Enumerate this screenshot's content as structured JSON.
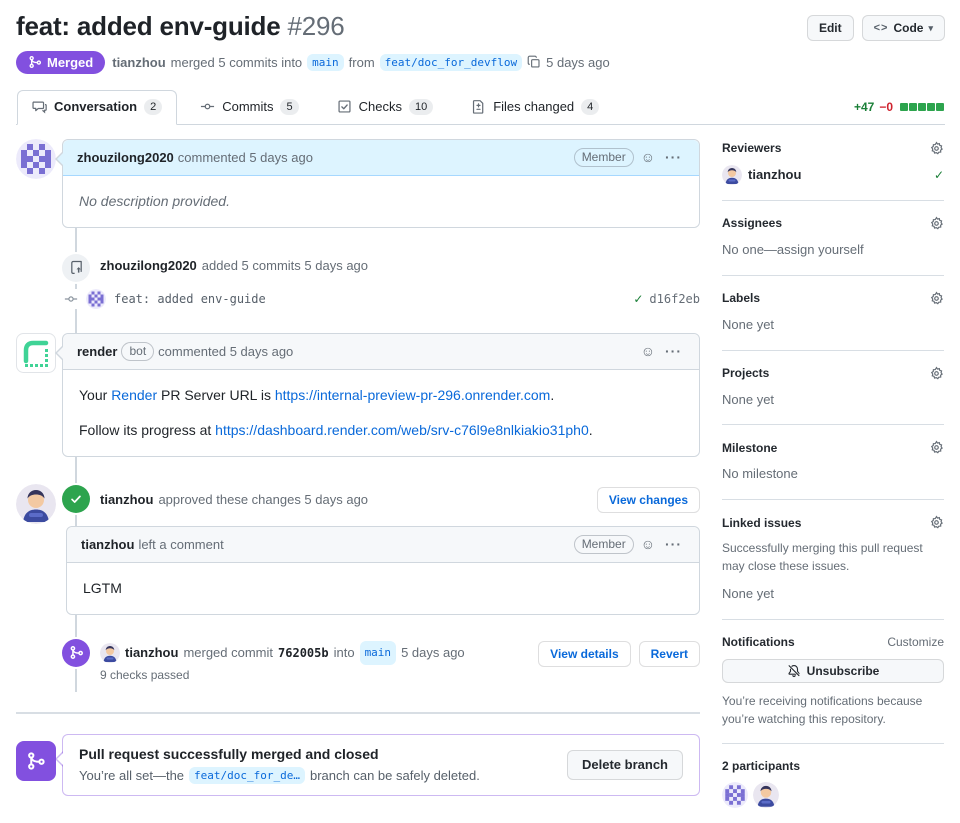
{
  "icons": {
    "smiley": "☺",
    "kebab": "···",
    "caret": "▾",
    "code_glyph": "<>",
    "check": "✓"
  },
  "header": {
    "title": "feat: added env-guide",
    "number": "#296",
    "edit_button": "Edit",
    "code_button": "Code",
    "state_badge": "Merged",
    "merge_summary": {
      "author": "tianzhou",
      "action": "merged 5 commits into",
      "base_branch": "main",
      "from_word": "from",
      "head_branch": "feat/doc_for_devflow",
      "time": "5 days ago"
    }
  },
  "tabs": [
    {
      "label": "Conversation",
      "count": "2"
    },
    {
      "label": "Commits",
      "count": "5"
    },
    {
      "label": "Checks",
      "count": "10"
    },
    {
      "label": "Files changed",
      "count": "4"
    }
  ],
  "diffstat": {
    "additions": "+47",
    "deletions": "−0"
  },
  "timeline": {
    "description_comment": {
      "author": "zhouzilong2020",
      "action": "commented 5 days ago",
      "badge": "Member",
      "body": "No description provided."
    },
    "commits_group": {
      "author": "zhouzilong2020",
      "action": "added 5 commits 5 days ago",
      "commit": {
        "message": "feat: added env-guide",
        "sha": "d16f2eb"
      }
    },
    "bot_comment": {
      "author": "render",
      "badge": "bot",
      "action": "commented 5 days ago",
      "line1_pre": "Your ",
      "line1_link1": "Render",
      "line1_mid": " PR Server URL is ",
      "line1_link2": "https://internal-preview-pr-296.onrender.com",
      "line1_end": ".",
      "line2_pre": "Follow its progress at ",
      "line2_link": "https://dashboard.render.com/web/srv-c76l9e8nlkiakio31ph0",
      "line2_end": "."
    },
    "review": {
      "author": "tianzhou",
      "action": "approved these changes 5 days ago",
      "view_changes_button": "View changes",
      "comment_author": "tianzhou",
      "comment_action": "left a comment",
      "badge": "Member",
      "body": "LGTM"
    },
    "merge_event": {
      "author": "tianzhou",
      "action": "merged commit",
      "sha": "762005b",
      "into_word": "into",
      "branch": "main",
      "time": "5 days ago",
      "checks_line": "9 checks passed",
      "view_details_button": "View details",
      "revert_button": "Revert"
    },
    "merged_banner": {
      "title": "Pull request successfully merged and closed",
      "pre_branch": "You’re all set—the",
      "branch": "feat/doc_for_de…",
      "post_branch": "branch can be safely deleted.",
      "delete_button": "Delete branch"
    }
  },
  "sidebar": {
    "reviewers": {
      "title": "Reviewers",
      "reviewer": "tianzhou"
    },
    "assignees": {
      "title": "Assignees",
      "empty": "No one—assign yourself"
    },
    "labels": {
      "title": "Labels",
      "empty": "None yet"
    },
    "projects": {
      "title": "Projects",
      "empty": "None yet"
    },
    "milestone": {
      "title": "Milestone",
      "empty": "No milestone"
    },
    "linked_issues": {
      "title": "Linked issues",
      "description": "Successfully merging this pull request may close these issues.",
      "empty": "None yet"
    },
    "notifications": {
      "title": "Notifications",
      "customize": "Customize",
      "button": "Unsubscribe",
      "caption": "You’re receiving notifications because you’re watching this repository."
    },
    "participants": {
      "title": "2 participants"
    }
  }
}
